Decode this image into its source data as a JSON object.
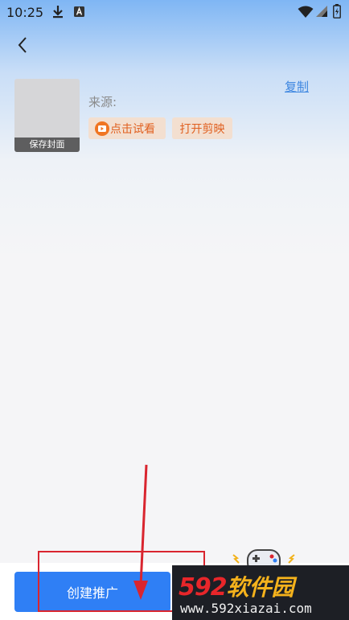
{
  "status_bar": {
    "time": "10:25",
    "icons": [
      "download-icon",
      "keyboard-a-icon",
      "wifi-icon",
      "signal-icon",
      "battery-icon"
    ]
  },
  "cover": {
    "label": "保存封面"
  },
  "source": {
    "label": "来源:"
  },
  "copy_link": "复制",
  "chips": {
    "preview": "点击试看",
    "open": "打开剪映"
  },
  "bottom": {
    "create_button": "创建推广"
  },
  "watermark": {
    "brand_prefix": "592",
    "brand_suffix": "软件园",
    "url": "www.592xiazai.com"
  },
  "colors": {
    "accent_blue": "#2f7ff5",
    "chip_bg": "#f3dfd0",
    "chip_text": "#e06020",
    "annotation_red": "#d9252f"
  }
}
